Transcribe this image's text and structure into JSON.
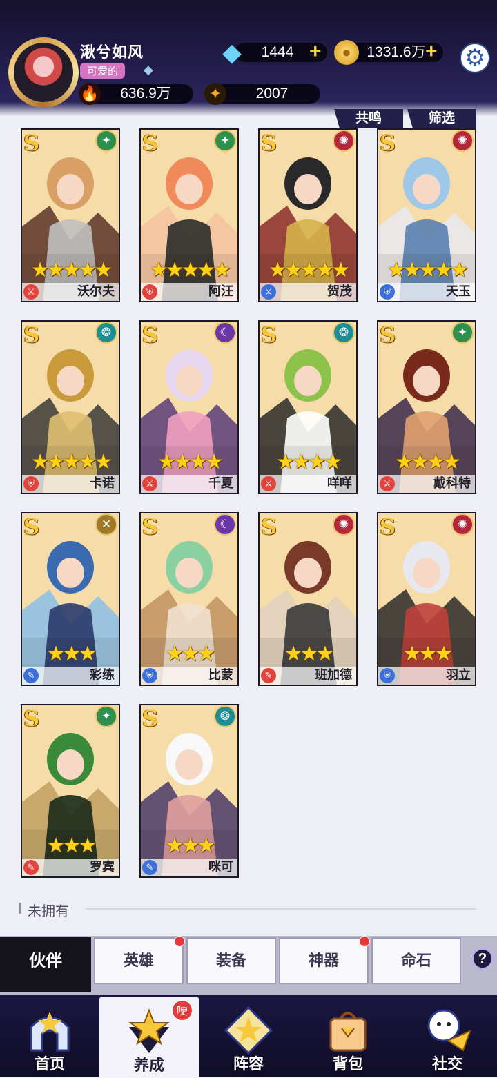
{
  "player": {
    "name": "湫兮如风",
    "title_badge": "可爱的",
    "power": "636.9万",
    "energy": "2007"
  },
  "currency": {
    "diamonds": "1444",
    "gold": "1331.6万"
  },
  "filters": {
    "resonance_label": "共鸣",
    "filter_label": "筛选"
  },
  "heroes": [
    {
      "name": "沃尔夫",
      "rank": "S",
      "stars": 5,
      "faction_color": "#2f8f4e",
      "faction_icon": "✦",
      "class_color": "#e0443d",
      "class_icon": "⚔"
    },
    {
      "name": "阿汪",
      "rank": "S",
      "stars": 5,
      "faction_color": "#2f8f4e",
      "faction_icon": "✦",
      "class_color": "#e0443d",
      "class_icon": "⛨"
    },
    {
      "name": "贺茂",
      "rank": "S",
      "stars": 5,
      "faction_color": "#b3283a",
      "faction_icon": "✺",
      "class_color": "#3c6fd8",
      "class_icon": "⚔"
    },
    {
      "name": "天玉",
      "rank": "S",
      "stars": 5,
      "faction_color": "#b3283a",
      "faction_icon": "✺",
      "class_color": "#3c6fd8",
      "class_icon": "⛨"
    },
    {
      "name": "卡诺",
      "rank": "S",
      "stars": 5,
      "faction_color": "#1b8e96",
      "faction_icon": "❂",
      "class_color": "#e0443d",
      "class_icon": "⛨"
    },
    {
      "name": "千夏",
      "rank": "S",
      "stars": 4,
      "faction_color": "#6a36a8",
      "faction_icon": "☾",
      "class_color": "#e0443d",
      "class_icon": "⚔"
    },
    {
      "name": "咩咩",
      "rank": "S",
      "stars": 4,
      "faction_color": "#1b8e96",
      "faction_icon": "❂",
      "class_color": "#e0443d",
      "class_icon": "⚔"
    },
    {
      "name": "戴科特",
      "rank": "S",
      "stars": 4,
      "faction_color": "#2f8f4e",
      "faction_icon": "✦",
      "class_color": "#e0443d",
      "class_icon": "⚔"
    },
    {
      "name": "彩练",
      "rank": "S",
      "stars": 3,
      "faction_color": "#a07a2a",
      "faction_icon": "✕",
      "class_color": "#3c6fd8",
      "class_icon": "✎"
    },
    {
      "name": "比蒙",
      "rank": "S",
      "stars": 3,
      "faction_color": "#6a36a8",
      "faction_icon": "☾",
      "class_color": "#3c6fd8",
      "class_icon": "⛨"
    },
    {
      "name": "班加德",
      "rank": "S",
      "stars": 3,
      "faction_color": "#b3283a",
      "faction_icon": "✺",
      "class_color": "#e0443d",
      "class_icon": "✎"
    },
    {
      "name": "羽立",
      "rank": "S",
      "stars": 3,
      "faction_color": "#b3283a",
      "faction_icon": "✺",
      "class_color": "#3c6fd8",
      "class_icon": "⛨"
    },
    {
      "name": "罗宾",
      "rank": "S",
      "stars": 3,
      "faction_color": "#2f8f4e",
      "faction_icon": "✦",
      "class_color": "#e0443d",
      "class_icon": "✎"
    },
    {
      "name": "咪可",
      "rank": "S",
      "stars": 3,
      "faction_color": "#1b8e96",
      "faction_icon": "❂",
      "class_color": "#3c6fd8",
      "class_icon": "✎"
    }
  ],
  "section": {
    "not_owned_label": "未拥有"
  },
  "subtabs": [
    {
      "label": "伙伴",
      "active": true,
      "dot": false
    },
    {
      "label": "英雄",
      "active": false,
      "dot": true
    },
    {
      "label": "装备",
      "active": false,
      "dot": false
    },
    {
      "label": "神器",
      "active": false,
      "dot": true
    },
    {
      "label": "命石",
      "active": false,
      "dot": false
    }
  ],
  "help_label": "?",
  "nav": [
    {
      "label": "首页",
      "active": false,
      "icon": "home-icon"
    },
    {
      "label": "养成",
      "active": true,
      "icon": "nurture-icon",
      "badge": "哽"
    },
    {
      "label": "阵容",
      "active": false,
      "icon": "lineup-icon"
    },
    {
      "label": "背包",
      "active": false,
      "icon": "bag-icon"
    },
    {
      "label": "社交",
      "active": false,
      "icon": "social-icon"
    }
  ]
}
